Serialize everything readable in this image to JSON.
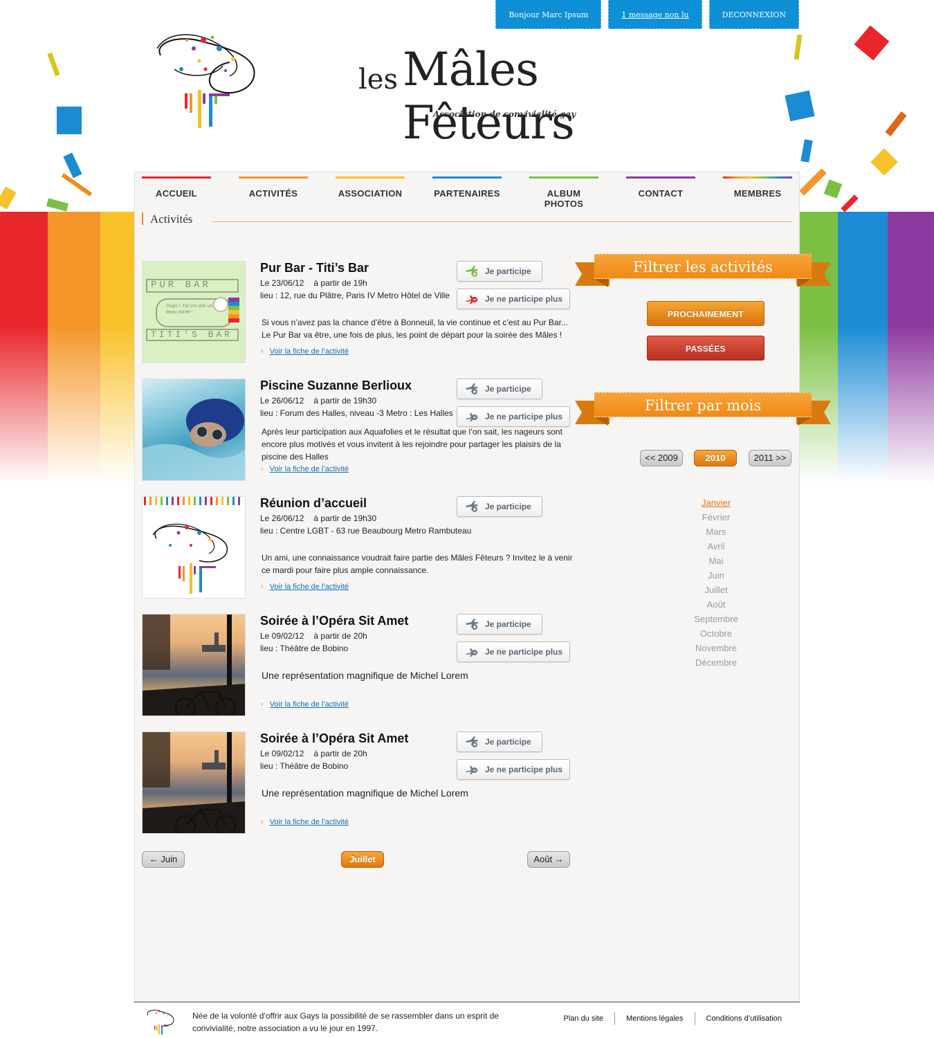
{
  "topbar": {
    "greeting": "Bonjour Marc Ipsum",
    "messages": "1 message non lu",
    "logout": "DECONNEXION"
  },
  "brand": {
    "les": "les",
    "name": "Mâles Fêteurs",
    "tagline": "Association de convivialité gay",
    "rainbow_colors": [
      "#e8262b",
      "#f4962a",
      "#f8c12a",
      "#ffffff",
      "#7bc043",
      "#1b8bd4",
      "#8e3aa0"
    ]
  },
  "nav": [
    {
      "label": "ACCUEIL",
      "color": "#e8262b"
    },
    {
      "label": "ACTIVITÉS",
      "color": "#f4962a"
    },
    {
      "label": "ASSOCIATION",
      "color": "#f8c12a"
    },
    {
      "label": "PARTENAIRES",
      "color": "#1b8bd4"
    },
    {
      "label": "ALBUM PHOTOS",
      "color": "#7bc043"
    },
    {
      "label": "CONTACT",
      "color": "#8e3aa0"
    },
    {
      "label": "MEMBRES",
      "color": "rainbow"
    }
  ],
  "section_title": "Activités",
  "activities": [
    {
      "title": "Pur Bar - Titi’s Bar",
      "date": "Le 23/06/12",
      "time": "à partir de 19h",
      "place": "lieu : 12, rue du Plâtre, Paris IV Metro Hôtel de Ville",
      "description": "Si vous n’avez pas la chance d’être à Bonneuil, la vie continue et c’est au Pur Bar... Le Pur Bar va être, une fois de plus, les point de départ pour la soirée des Mâles !",
      "link": "Voir la fiche de l’activité",
      "participate": "Je participe",
      "unparticipate": "Je ne participe plus",
      "status": "participating",
      "thumb_text_top": "PUR BAR",
      "thumb_text_mid": "Oups ! J'ai cru voir un beau minet !",
      "thumb_text_bottom": "TITI'S BAR"
    },
    {
      "title": "Piscine Suzanne Berlioux",
      "date": "Le 26/06/12",
      "time": "à partir de 19h30",
      "place": "lieu : Forum des Halles, niveau -3 Metro : Les Halles",
      "description": "Après leur participation aux Aquafolies et le résultat que l’on sait, les nageurs sont encore plus motivés et vous invitent à les rejoindre pour partager les plaisirs de la piscine des Halles",
      "link": "Voir la fiche de l’activité",
      "participate": "Je participe",
      "unparticipate": "Je ne participe plus",
      "status": "neutral"
    },
    {
      "title": "Réunion d’accueil",
      "date": "Le 26/06/12",
      "time": "à partir de 19h30",
      "place": "lieu : Centre LGBT - 63 rue Beaubourg Metro Rambuteau",
      "description": "Un ami, une connaissance voudrait faire partie des Mâles Fêteurs ? Invitez le à venir ce mardi pour faire plus ample connaissance.",
      "link": "Voir la fiche de l’activité",
      "participate": "Je participe",
      "status": "neutral"
    },
    {
      "title": "Soirée à l’Opéra Sit Amet",
      "date": "Le 09/02/12",
      "time": "à partir de 20h",
      "place": "lieu : Théâtre de Bobino",
      "description": "Une représentation magnifique de Michel Lorem",
      "link": "Voir la fiche de l’activité",
      "participate": "Je participe",
      "unparticipate": "Je ne participe plus",
      "status": "neutral"
    },
    {
      "title": "Soirée à l’Opéra Sit Amet",
      "date": "Le 09/02/12",
      "time": "à partir de 20h",
      "place": "lieu : Théâtre de Bobino",
      "description": "Une représentation magnifique de Michel Lorem",
      "link": "Voir la fiche de l’activité",
      "participate": "Je participe",
      "unparticipate": "Je ne participe plus",
      "status": "neutral"
    }
  ],
  "pagination": {
    "prev": "← Juin",
    "current": "Juillet",
    "next": "Août →"
  },
  "sidebar": {
    "filter_activities_title": "Filtrer les activités",
    "upcoming": "PROCHAINEMENT",
    "past": "PASSÉES",
    "filter_month_title": "Filtrer par mois",
    "year_prev": "<< 2009",
    "year_current": "2010",
    "year_next": "2011 >>",
    "months": [
      "Janvier",
      "Février",
      "Mars",
      "Avril",
      "Mai",
      "Juin",
      "Juillet",
      "Août",
      "Septembre",
      "Octobre",
      "Novembre",
      "Décembre"
    ],
    "selected_month": "Janvier"
  },
  "footer": {
    "text": "Née de la volonté d'offrir aux Gays la possibilité de se rassembler dans un esprit de convivialité, notre association a vu le jour en 1997.",
    "links": [
      "Plan du site",
      "Mentions légales",
      "Conditions d’utilisation"
    ]
  }
}
